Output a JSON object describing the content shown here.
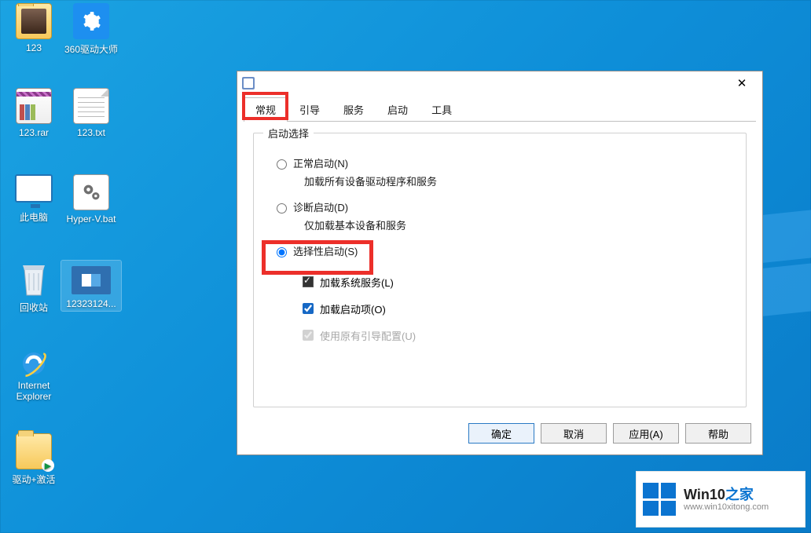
{
  "desktop": {
    "icons": {
      "folder123": "123",
      "driver": "360驱动大师",
      "rar": "123.rar",
      "txt": "123.txt",
      "thispc": "此电脑",
      "bat": "Hyper-V.bat",
      "bin": "回收站",
      "vid": "1232312​4...",
      "ie_line1": "Internet",
      "ie_line2": "Explorer",
      "activate": "驱动+激活"
    }
  },
  "dialog": {
    "tabs": {
      "general": "常规",
      "boot": "引导",
      "services": "服务",
      "startup": "启动",
      "tools": "工具"
    },
    "group": {
      "legend": "启动选择",
      "normal": "正常启动(N)",
      "normal_desc": "加载所有设备驱动程序和服务",
      "diag": "诊断启动(D)",
      "diag_desc": "仅加载基本设备和服务",
      "selective": "选择性启动(S)",
      "load_services": "加载系统服务(L)",
      "load_startup": "加载启动项(O)",
      "use_boot": "使用原有引导配置(U)"
    },
    "buttons": {
      "ok": "确定",
      "cancel": "取消",
      "apply": "应用(A)",
      "help": "帮助"
    }
  },
  "watermark": {
    "brand_prefix": "Win10",
    "brand_suffix": "之家",
    "url": "www.win10xitong.com"
  }
}
